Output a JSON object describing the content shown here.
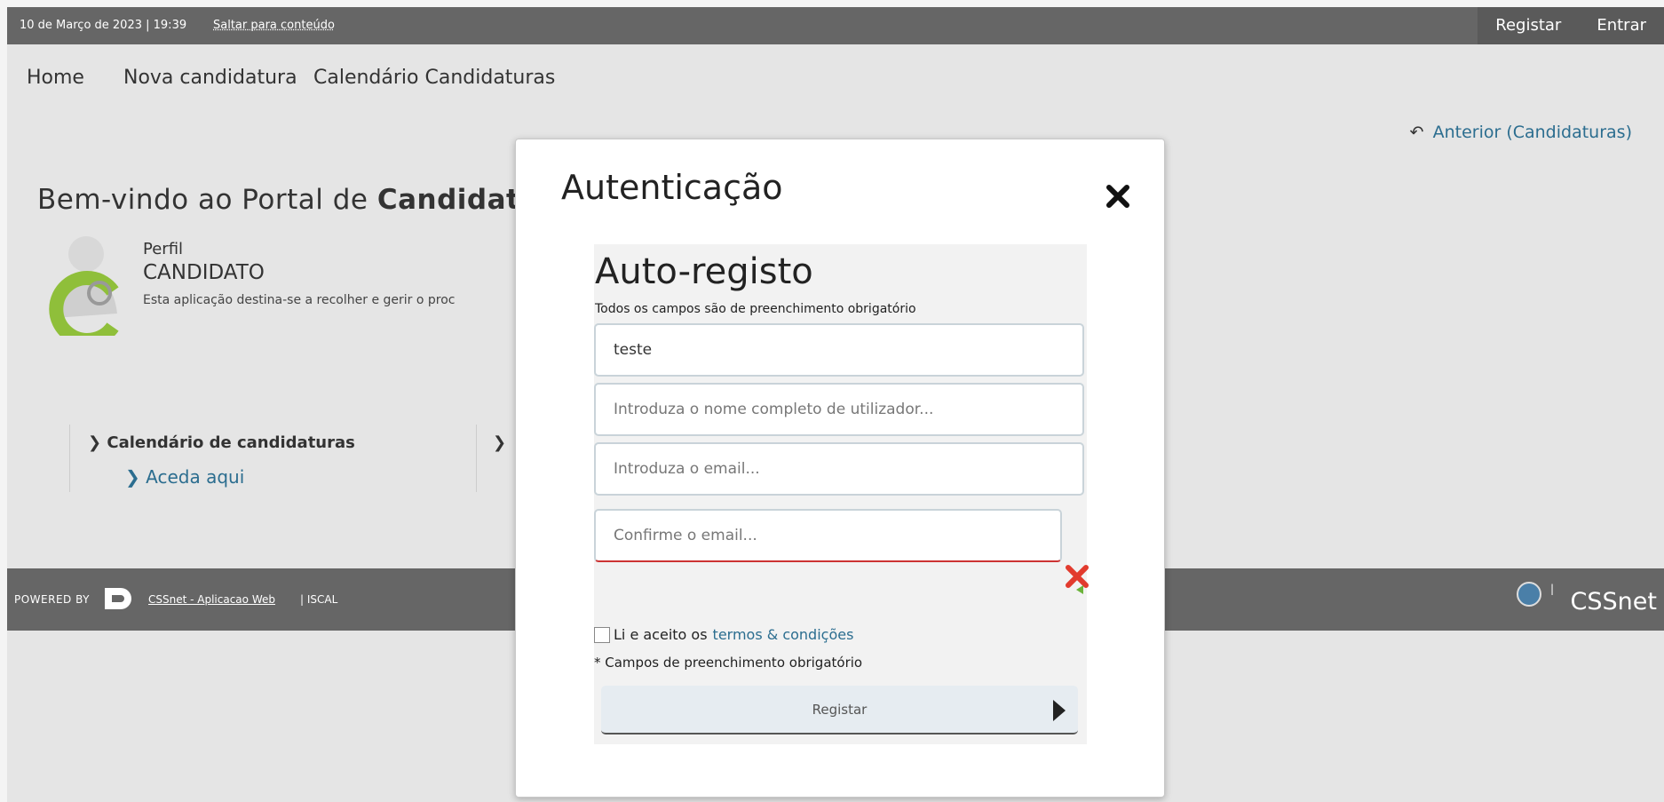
{
  "topbar": {
    "date": "10 de Março de 2023 | 19:39",
    "skip_link": "Saltar para conteúdo",
    "register": "Registar",
    "login": "Entrar"
  },
  "nav": {
    "items": [
      "Home",
      "Nova candidatura",
      "Calendário Candidaturas"
    ]
  },
  "back_link": "Anterior (Candidaturas)",
  "welcome": {
    "prefix": "Bem-vindo ao Portal de ",
    "bold": "Candidatur"
  },
  "profile": {
    "label": "Perfil",
    "value": "CANDIDATO",
    "description": "Esta aplicação destina-se a recolher e gerir o proc"
  },
  "links": {
    "calendar": "Calendário de candidaturas",
    "access": "Aceda aqui"
  },
  "footer": {
    "powered_by": "Powered by",
    "app_link": "CSSnet - Aplicacao Web",
    "org": "| ISCAL",
    "brand": "CSSnet"
  },
  "modal": {
    "title": "Autenticação",
    "form": {
      "title": "Auto-registo",
      "note": "Todos os campos são de preenchimento obrigatório",
      "username_value": "teste",
      "fullname_placeholder": "Introduza o nome completo de utilizador...",
      "email_placeholder": "Introduza o email...",
      "confirm_placeholder": "Confirme o email...",
      "terms_prefix": "Li e aceito os",
      "terms_link": "termos & condições",
      "required_note": "* Campos de preenchimento obrigatório",
      "submit_label": "Registar"
    }
  }
}
